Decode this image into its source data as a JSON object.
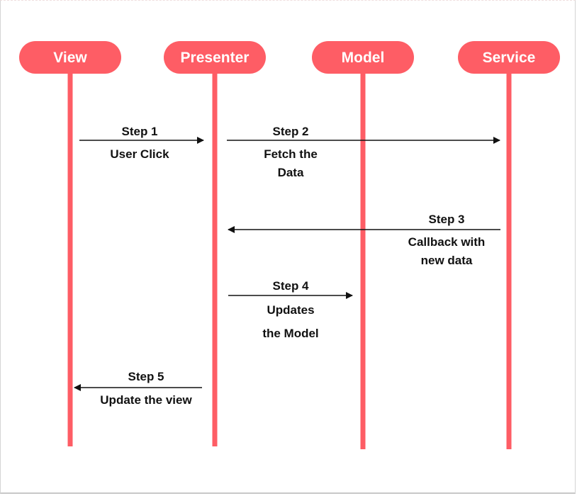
{
  "diagram": {
    "type": "sequence-diagram",
    "colors": {
      "actor": "#fe5d65",
      "lifeline": "#fe5d65",
      "arrow": "#111111",
      "text": "#111111",
      "actor_text": "#ffffff",
      "background": "#ffffff"
    },
    "actors": [
      {
        "id": "view",
        "label": "View"
      },
      {
        "id": "presenter",
        "label": "Presenter"
      },
      {
        "id": "model",
        "label": "Model"
      },
      {
        "id": "service",
        "label": "Service"
      }
    ],
    "messages": [
      {
        "step": "Step 1",
        "from": "view",
        "to": "presenter",
        "lines": [
          "User Click"
        ]
      },
      {
        "step": "Step 2",
        "from": "presenter",
        "to": "service",
        "lines": [
          "Fetch the",
          "Data"
        ]
      },
      {
        "step": "Step 3",
        "from": "service",
        "to": "presenter",
        "lines": [
          "Callback with",
          "new data"
        ]
      },
      {
        "step": "Step 4",
        "from": "presenter",
        "to": "model",
        "lines": [
          "Updates",
          "the Model"
        ]
      },
      {
        "step": "Step 5",
        "from": "presenter",
        "to": "view",
        "lines": [
          "Update the view"
        ]
      }
    ]
  }
}
